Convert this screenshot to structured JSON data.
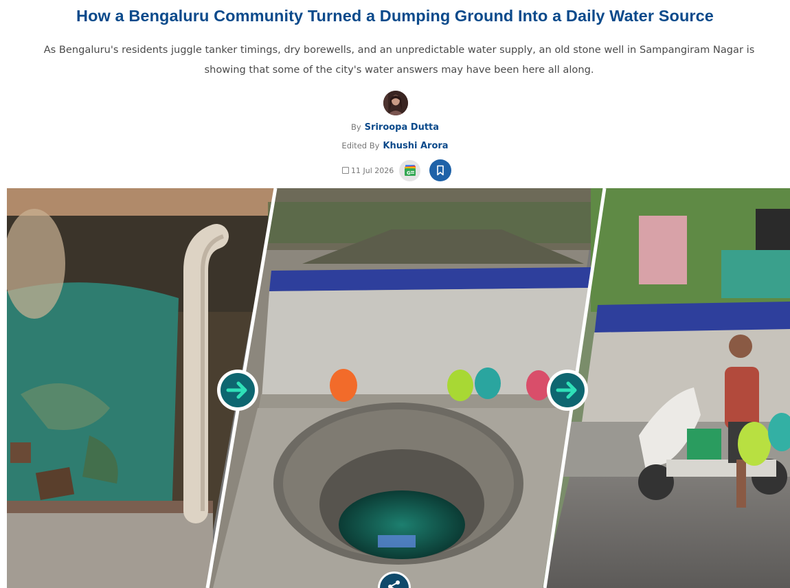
{
  "article": {
    "title": "How a Bengaluru Community Turned a Dumping Ground Into a Daily Water Source",
    "subtitle_line1": "As Bengaluru's residents juggle tanker timings, dry borewells, and an unpredictable water supply, an old stone well in Sampangiram Nagar is",
    "subtitle_line2": "showing that some of the city's water answers may have been here all along.",
    "author_label": "By",
    "author_name": "Sriroopa Dutta",
    "editor_label": "Edited By",
    "editor_name": "Khushi Arora",
    "date": "11 Jul 2026"
  },
  "icons": {
    "calendar": "calendar-icon",
    "google_news": "google-news-icon",
    "bookmark": "bookmark-icon",
    "arrow": "arrow-right-icon",
    "share": "share-icon"
  },
  "colors": {
    "title": "#0b4a8b",
    "author": "#0b4a8b",
    "bookmark_bg": "#1f62a8",
    "arrow_bg": "#0e6670",
    "share_bg": "#0f4a6b"
  }
}
